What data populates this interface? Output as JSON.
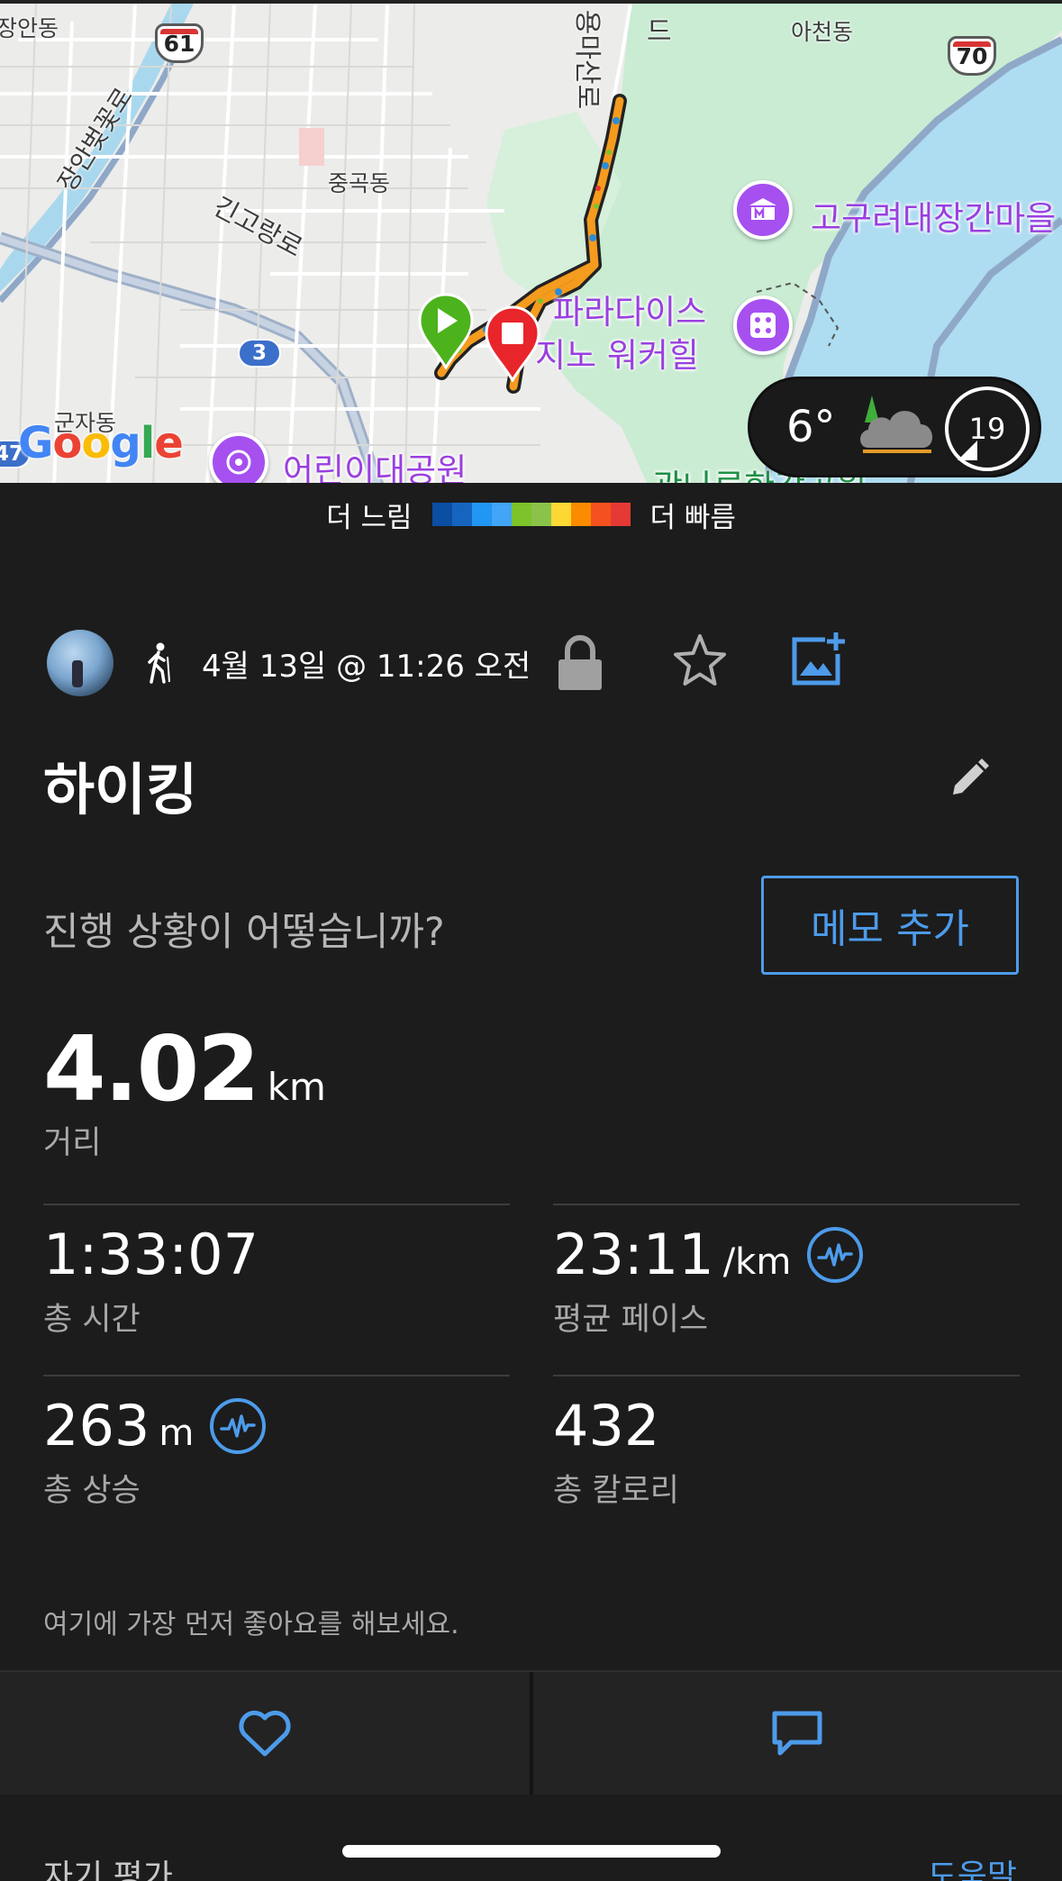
{
  "map": {
    "labels": {
      "jangan": "장안동",
      "acheon": "아천동",
      "junggok": "중곡동",
      "ginkogang": "긴고랑로",
      "janganbeotkkot": "장안벚꽃로",
      "gunja": "군자동",
      "road_fragment_top": "드",
      "road_fragment_vertical": "용마산로"
    },
    "shields": {
      "route61": "61",
      "route70": "70",
      "route3": "3",
      "route47": "47"
    },
    "pois": {
      "goguryeo": "고구려대장간마을",
      "paradise_line1": "파라다이스",
      "paradise_line2": "지노 워커힐",
      "childrens_park": "어린이대공원",
      "gwangnaru": "광나루한강공원"
    },
    "google_logo": "Google",
    "weather": {
      "temperature": "6°",
      "wind_speed": "19"
    }
  },
  "legend": {
    "slower": "더 느림",
    "faster": "더 빠름",
    "colors": [
      "#0b4ea2",
      "#1565c0",
      "#2196f3",
      "#42a5f5",
      "#7cc42a",
      "#8bc34a",
      "#fdd835",
      "#fb8c00",
      "#f4511e",
      "#e53935"
    ]
  },
  "activity": {
    "date": "4월 13일 @ 11:26 오전",
    "title": "하이킹",
    "prompt": "진행 상황이 어떻습니까?",
    "memo_button": "메모 추가"
  },
  "stats": {
    "distance": {
      "value": "4.02",
      "unit": "km",
      "label": "거리"
    },
    "total_time": {
      "value": "1:33:07",
      "label": "총 시간"
    },
    "avg_pace": {
      "value": "23:11",
      "unit": "/km",
      "label": "평균 페이스"
    },
    "total_ascent": {
      "value": "263",
      "unit": "m",
      "label": "총 상승"
    },
    "calories": {
      "value": "432",
      "label": "총 칼로리"
    }
  },
  "kudos_text": "여기에 가장 먼저 좋아요를 해보세요.",
  "footer": {
    "self_evaluation": "자기 평가",
    "help": "도움말"
  },
  "colors": {
    "accent": "#4d9bea",
    "background": "#1c1c1c",
    "start_marker": "#4cb31c",
    "stop_marker": "#e8252b",
    "poi": "#a650f0"
  }
}
